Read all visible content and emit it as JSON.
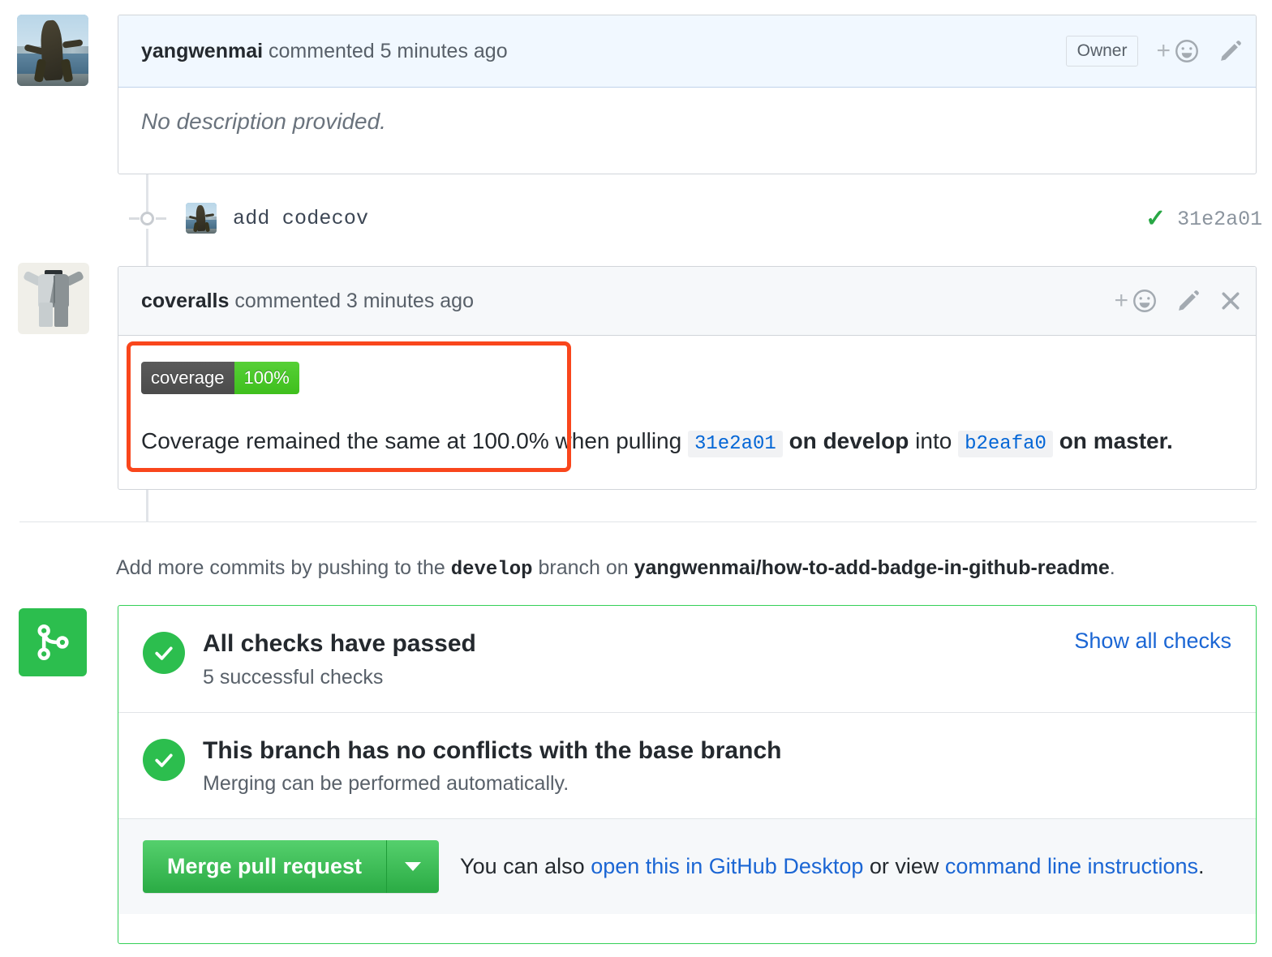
{
  "comment1": {
    "author": "yangwenmai",
    "meta": " commented 5 minutes ago",
    "badge": "Owner",
    "body": "No description provided.",
    "actions": {
      "react": "add-reaction",
      "edit": "edit"
    }
  },
  "commit": {
    "message": "add  codecov",
    "sha": "31e2a01",
    "status_icon": "check"
  },
  "comment2": {
    "author": "coveralls",
    "meta": " commented 3 minutes ago",
    "coverage_badge": {
      "label": "coverage",
      "value": "100%"
    },
    "body_parts": {
      "p1": "Coverage remained the same at 100.0% when pulling ",
      "sha_head": "31e2a01",
      "p2": " on develop ",
      "p3": "into ",
      "sha_base": "b2eafa0",
      "p4": " on master."
    },
    "actions": {
      "react": "add-reaction",
      "edit": "edit",
      "close": "hide"
    }
  },
  "push_notice": {
    "p1": "Add more commits by pushing to the ",
    "branch": "develop",
    "p2": " branch on ",
    "repo": "yangwenmai/how-to-add-badge-in-github-readme",
    "p3": "."
  },
  "merge_box": {
    "checks": {
      "title": "All checks have passed",
      "subtitle": "5 successful checks",
      "link": "Show all checks"
    },
    "conflicts": {
      "title": "This branch has no conflicts with the base branch",
      "subtitle": "Merging can be performed automatically."
    },
    "footer": {
      "button": "Merge pull request",
      "caret": "merge-options",
      "t1": "You can also ",
      "link1": "open this in GitHub Desktop",
      "t2": " or view ",
      "link2": "command line instructions",
      "t3": "."
    }
  },
  "colors": {
    "green": "#2cbe4e",
    "link_blue": "#1b66d4",
    "annotation_red": "#f9461c",
    "badge_gray": "#4b4b4b",
    "badge_green": "#3fbf1d"
  }
}
